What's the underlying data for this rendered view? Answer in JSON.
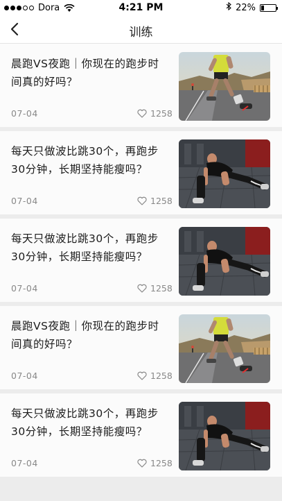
{
  "status_bar": {
    "carrier": "Dora",
    "time": "4:21 PM",
    "battery": "22%",
    "battery_level": 0.22
  },
  "nav": {
    "title": "训练",
    "back_icon": "chevron-left-icon"
  },
  "articles": [
    {
      "title": "晨跑VS夜跑｜你现在的跑步时间真的好吗？",
      "date": "07-04",
      "likes": "1258",
      "image": "road-runner-photo"
    },
    {
      "title": "每天只做波比跳30个，再跑步30分钟，长期坚持能瘦吗？",
      "date": "07-04",
      "likes": "1258",
      "image": "stretching-athlete-photo"
    },
    {
      "title": "每天只做波比跳30个，再跑步30分钟，长期坚持能瘦吗？",
      "date": "07-04",
      "likes": "1258",
      "image": "stretching-athlete-photo"
    },
    {
      "title": "晨跑VS夜跑｜你现在的跑步时间真的好吗？",
      "date": "07-04",
      "likes": "1258",
      "image": "road-runner-photo"
    },
    {
      "title": "每天只做波比跳30个，再跑步30分钟，长期坚持能瘦吗？",
      "date": "07-04",
      "likes": "1258",
      "image": "stretching-athlete-photo"
    }
  ]
}
